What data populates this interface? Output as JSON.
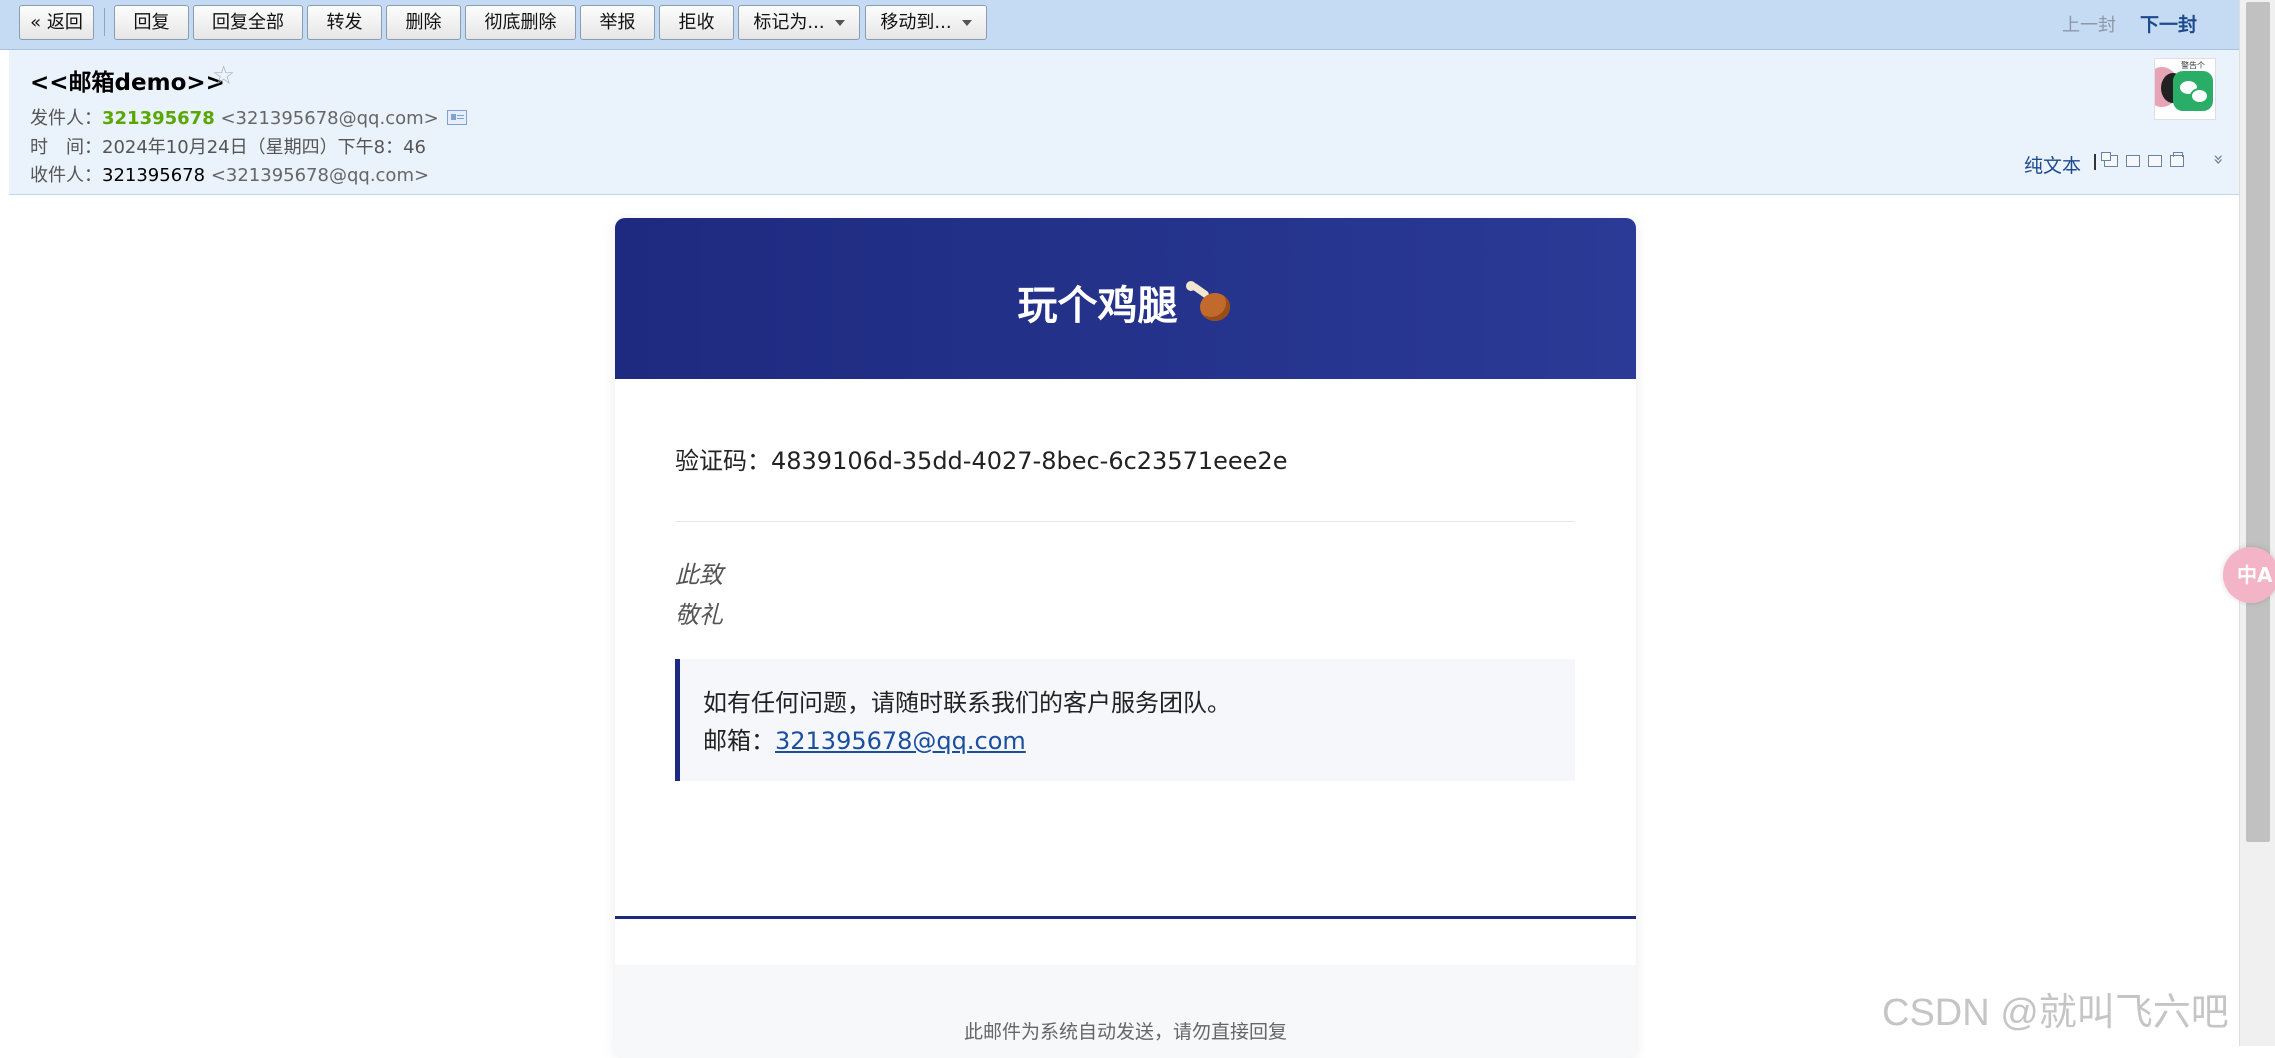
{
  "toolbar": {
    "back": "« 返回",
    "reply": "回复",
    "reply_all": "回复全部",
    "forward": "转发",
    "delete": "删除",
    "delete_permanent": "彻底删除",
    "report": "举报",
    "reject": "拒收",
    "mark_as": "标记为...",
    "move_to": "移动到...",
    "prev": "上一封",
    "next": "下一封"
  },
  "header": {
    "subject": "<<邮箱demo>>",
    "from_label": "发件人：",
    "from_name": "321395678",
    "from_addr": "<321395678@qq.com>",
    "time_label": "时　间：",
    "time_value": "2024年10月24日（星期四）下午8：46",
    "to_label": "收件人：",
    "to_name": "321395678",
    "to_addr": "<321395678@qq.com>",
    "avatar_tag": "警告个",
    "plain_text": "纯文本"
  },
  "email": {
    "title": "玩个鸡腿",
    "code_label": "验证码：",
    "code_value": "4839106d-35dd-4027-8bec-6c23571eee2e",
    "sign_1": "此致",
    "sign_2": "敬礼",
    "contact_line": "如有任何问题，请随时联系我们的客户服务团队。",
    "contact_email_label": "邮箱：",
    "contact_email": "321395678@qq.com",
    "footer": "此邮件为系统自动发送，请勿直接回复"
  },
  "overlay": {
    "translate": "中A",
    "watermark": "CSDN @就叫飞六吧"
  },
  "colors": {
    "toolbar_bg": "#c5daf3",
    "header_bg": "#eaf2fc",
    "banner": "#1e2a7f",
    "sender_green": "#5aa700",
    "link": "#1a4fa0"
  }
}
